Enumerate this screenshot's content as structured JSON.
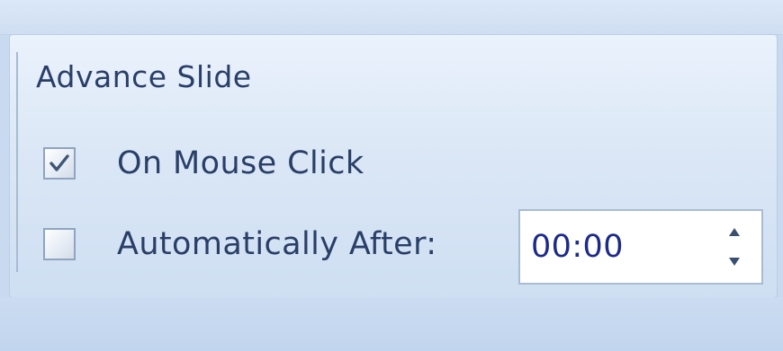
{
  "group": {
    "title": "Advance Slide"
  },
  "on_mouse_click": {
    "label": "On Mouse Click",
    "checked": true
  },
  "automatically_after": {
    "label": "Automatically After:",
    "checked": false,
    "value": "00:00"
  },
  "icons": {
    "checkmark": "checkmark-icon",
    "spin_up": "spin-up-arrow-icon",
    "spin_down": "spin-down-arrow-icon"
  },
  "colors": {
    "text": "#2a3f68",
    "value_text": "#1c2a8a",
    "panel": "#dbe7f6"
  }
}
